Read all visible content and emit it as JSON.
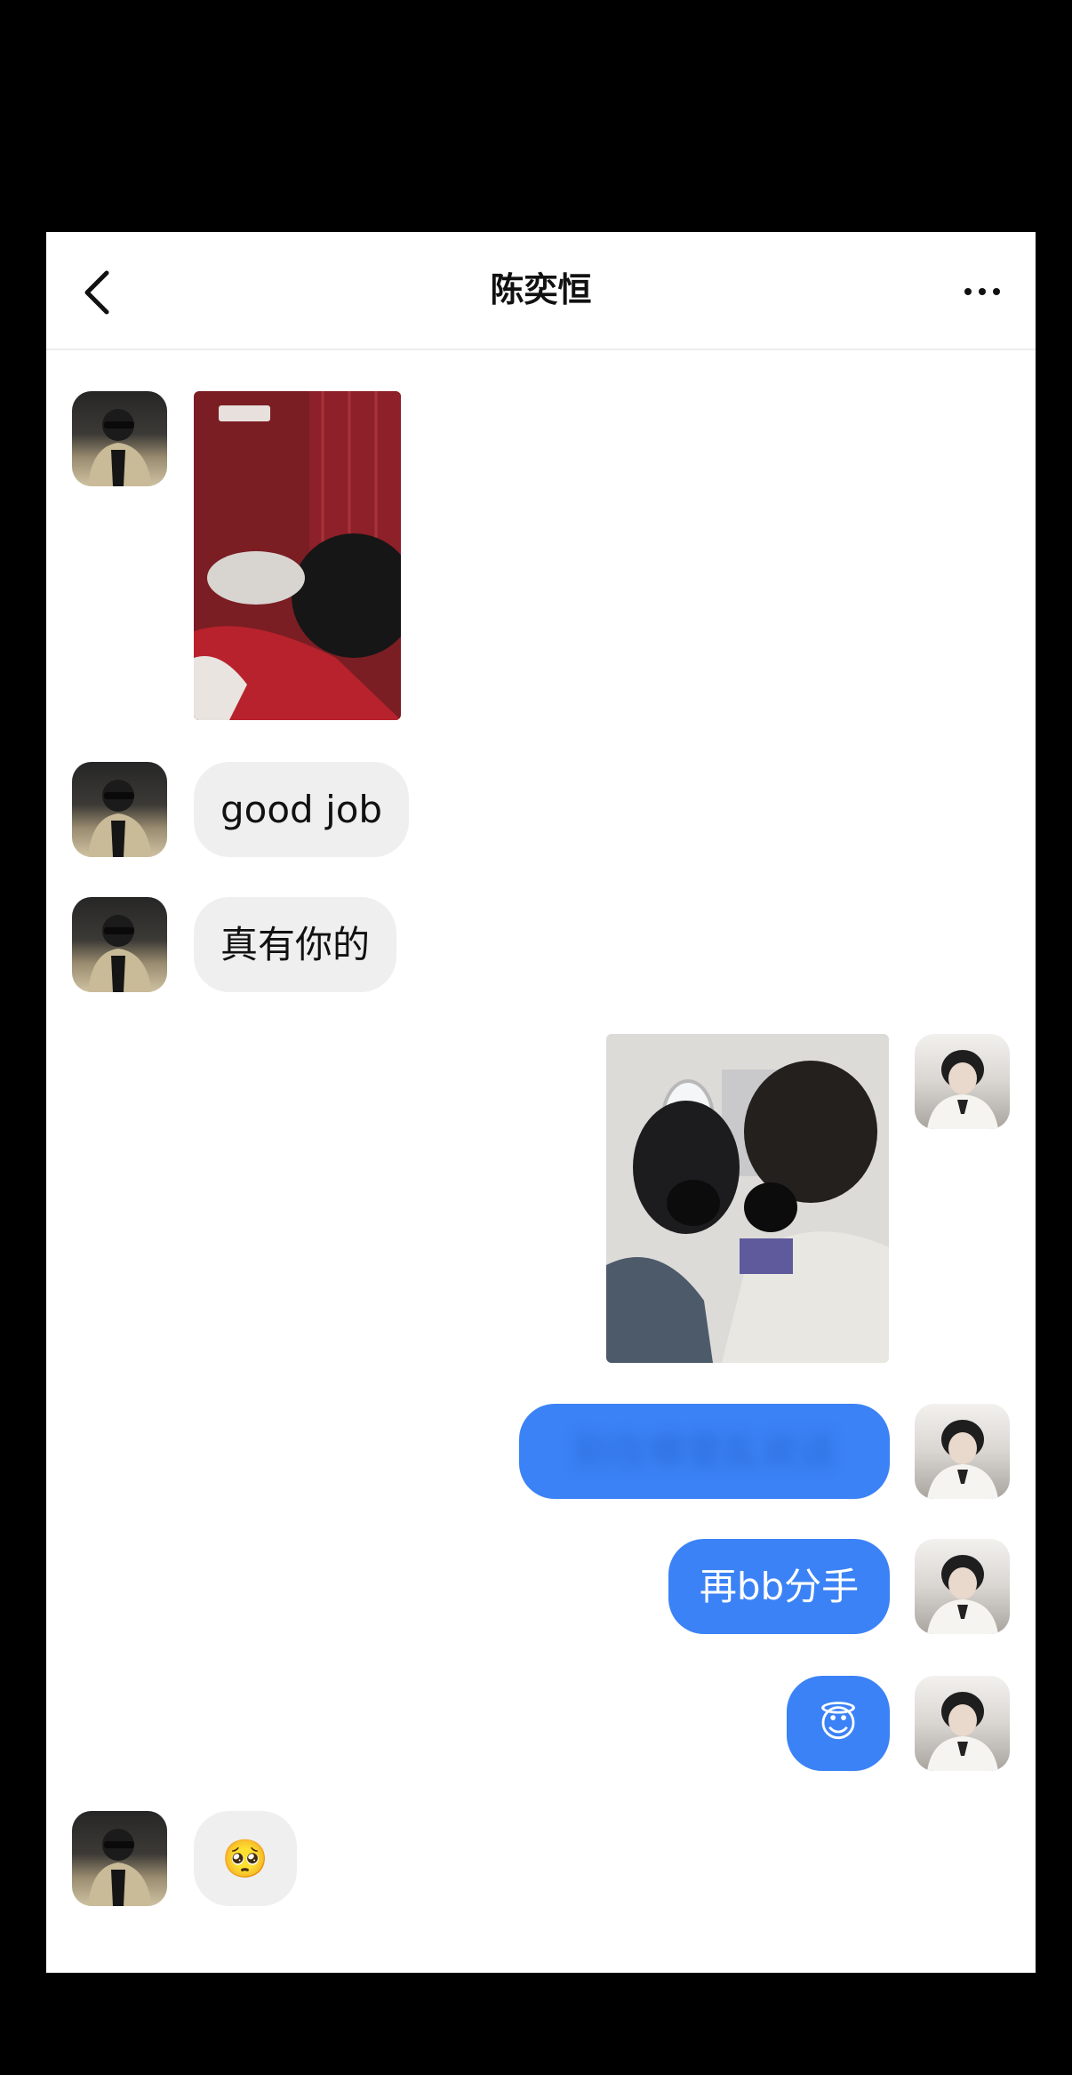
{
  "header": {
    "title": "陈奕恒"
  },
  "messages": {
    "m2_text": "good job",
    "m3_text": "真有你的",
    "m5_text": "别在哪里乱说话",
    "m6_text": "再bb分手",
    "m7_text": "😇",
    "m8_text": "🥺"
  },
  "colors": {
    "outgoing_bubble": "#3b82f6",
    "incoming_bubble": "#efefef",
    "background": "#ffffff"
  },
  "icons": {
    "back": "chevron-left-icon",
    "more": "more-dots-icon"
  }
}
